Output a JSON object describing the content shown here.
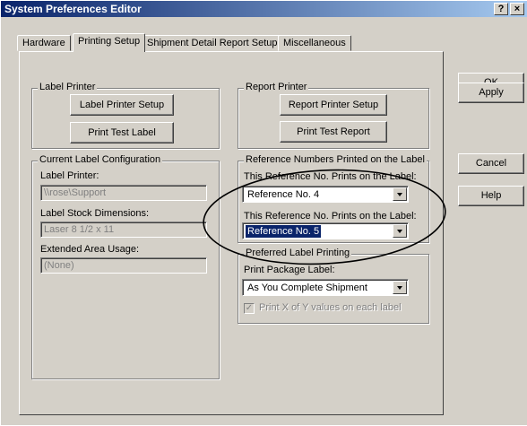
{
  "window": {
    "title": "System Preferences Editor",
    "help_btn": "?",
    "close_btn": "×"
  },
  "tabs": [
    "Hardware",
    "Printing Setup",
    "Shipment Detail Report Setup",
    "Miscellaneous"
  ],
  "right_buttons": {
    "ok": "OK",
    "apply": "Apply",
    "cancel": "Cancel",
    "help": "Help"
  },
  "label_printer": {
    "title": "Label Printer",
    "setup_button": "Label Printer Setup",
    "test_button": "Print Test Label"
  },
  "report_printer": {
    "title": "Report Printer",
    "setup_button": "Report Printer Setup",
    "test_button": "Print Test Report"
  },
  "current_config": {
    "title": "Current Label Configuration",
    "printer_label": "Label Printer:",
    "printer_value": "\\\\rose\\Support",
    "stock_label": "Label Stock Dimensions:",
    "stock_value": "Laser 8 1/2 x 11",
    "extended_label": "Extended Area Usage:",
    "extended_value": "(None)"
  },
  "reference_numbers": {
    "title": "Reference Numbers Printed on the Label",
    "ref1_label": "This Reference No. Prints on the Label:",
    "ref1_value": "Reference No. 4",
    "ref2_label": "This Reference No. Prints on the Label:",
    "ref2_value": "Reference No. 5"
  },
  "preferred_printing": {
    "title": "Preferred Label Printing",
    "package_label": "Print Package Label:",
    "package_value": "As You Complete Shipment",
    "xofy_label": "Print X of Y values on each label",
    "xofy_checked": true
  }
}
